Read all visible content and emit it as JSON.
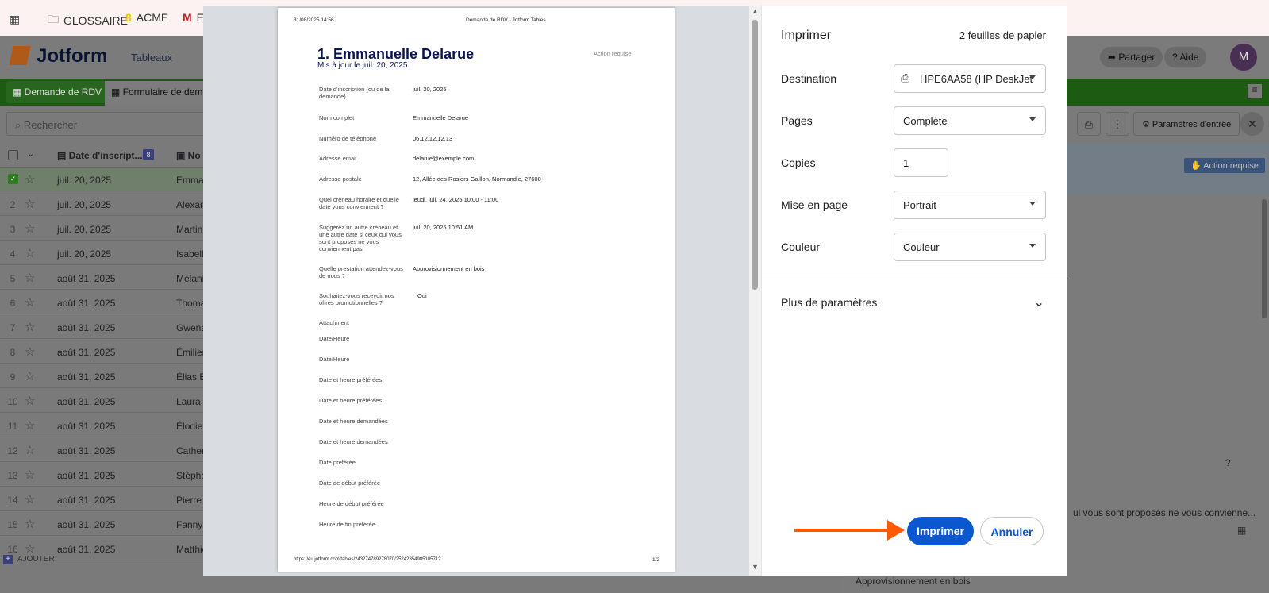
{
  "bookmarks": {
    "items": [
      "GLOSSAIRE",
      "ACME",
      "E"
    ]
  },
  "header": {
    "brand": "Jotform",
    "tableaux": "Tableaux",
    "share": "Partager",
    "help": "Aide",
    "avatar": "M"
  },
  "tabs": [
    "Demande de RDV",
    "Formulaire de demar"
  ],
  "toolbar": {
    "search_placeholder": "Rechercher",
    "params": "Paramètres d'entrée"
  },
  "table": {
    "col_date": "Date d'inscript...",
    "col_date_badge": "8",
    "col_name": "No",
    "rows": [
      {
        "n": "",
        "date": "juil. 20, 2025",
        "name": "Emman"
      },
      {
        "n": "2",
        "date": "juil. 20, 2025",
        "name": "Alexand"
      },
      {
        "n": "3",
        "date": "juil. 20, 2025",
        "name": "Martin"
      },
      {
        "n": "4",
        "date": "juil. 20, 2025",
        "name": "Isabelle"
      },
      {
        "n": "5",
        "date": "août 31, 2025",
        "name": "Mélanie"
      },
      {
        "n": "6",
        "date": "août 31, 2025",
        "name": "Thomas"
      },
      {
        "n": "7",
        "date": "août 31, 2025",
        "name": "Gwenaë"
      },
      {
        "n": "8",
        "date": "août 31, 2025",
        "name": "Émilien"
      },
      {
        "n": "9",
        "date": "août 31, 2025",
        "name": "Élias Bo"
      },
      {
        "n": "10",
        "date": "août 31, 2025",
        "name": "Laura R"
      },
      {
        "n": "11",
        "date": "août 31, 2025",
        "name": "Élodie T"
      },
      {
        "n": "12",
        "date": "août 31, 2025",
        "name": "Catheri"
      },
      {
        "n": "13",
        "date": "août 31, 2025",
        "name": "Stéphar"
      },
      {
        "n": "14",
        "date": "août 31, 2025",
        "name": "Pierre R"
      },
      {
        "n": "15",
        "date": "août 31, 2025",
        "name": "Fanny R"
      },
      {
        "n": "16",
        "date": "août 31, 2025",
        "name": "Matthie"
      }
    ],
    "add": "AJOUTER"
  },
  "right_panel": {
    "badge": "Action requise",
    "snippet1": "?",
    "snippet2": "ul vous sont proposés ne vous convienne...",
    "snippet3": "Approvisionnement en bois"
  },
  "print": {
    "title": "Imprimer",
    "sheets": "2 feuilles de papier",
    "destination_label": "Destination",
    "destination_value": "HPE6AA58 (HP DeskJet",
    "pages_label": "Pages",
    "pages_value": "Complète",
    "copies_label": "Copies",
    "copies_value": "1",
    "layout_label": "Mise en page",
    "layout_value": "Portrait",
    "color_label": "Couleur",
    "color_value": "Couleur",
    "more_label": "Plus de paramètres",
    "print_button": "Imprimer",
    "cancel_button": "Annuler"
  },
  "paper": {
    "header_date": "31/08/2025 14:56",
    "header_title": "Demande de RDV - Jotform Tables",
    "title": "1. Emmanuelle Delarue",
    "subtitle": "Mis à jour le juil. 20, 2025",
    "status": "Action requise",
    "fields": [
      {
        "label": "Date d'inscription (ou de la demande)",
        "value": "juil. 20, 2025"
      },
      {
        "label": "Nom complet",
        "value": "Emmanuelle Delarue"
      },
      {
        "label": "Numéro de téléphone",
        "value": "06.12.12.12.13"
      },
      {
        "label": "Adresse email",
        "value": "delarue@exemple.com"
      },
      {
        "label": "Adresse postale",
        "value": "12, Allée des Rosiers Gaillon, Normandie, 27600"
      },
      {
        "label": "Quel créneau horaire et quelle date vous conviennent ?",
        "value": "jeudi, juil. 24, 2025 10:00 - 11:00"
      },
      {
        "label": "Suggérez un autre créneau et une autre date si ceux qui vous sont proposés ne vous conviennent pas",
        "value": "juil. 20, 2025 10:51 AM"
      },
      {
        "label": "Quelle prestation attendez-vous de nous ?",
        "value": "Approvisionnement en bois"
      },
      {
        "label": "Souhaitez-vous recevoir nos offres promotionnelles ?",
        "value": "Oui"
      },
      {
        "label": "Attachment",
        "value": ""
      },
      {
        "label": "Date/Heure",
        "value": ""
      },
      {
        "label": "Date/Heure",
        "value": ""
      },
      {
        "label": "Date et heure préférées",
        "value": ""
      },
      {
        "label": "Date et heure préférées",
        "value": ""
      },
      {
        "label": "Date et heure demandées",
        "value": ""
      },
      {
        "label": "Date et heure demandées",
        "value": ""
      },
      {
        "label": "Date préférée",
        "value": ""
      },
      {
        "label": "Date de début préférée",
        "value": ""
      },
      {
        "label": "Heure de début préférée",
        "value": ""
      },
      {
        "label": "Heure de fin préférée",
        "value": ""
      }
    ],
    "footer_url": "https://eu.jotform.com/tables/243274789278070/2524235498510571?",
    "footer_page": "1/2"
  },
  "colors": {
    "accent": "#0b57d0",
    "arrow": "#ff5a00",
    "jotform_navy": "#0a1551"
  }
}
